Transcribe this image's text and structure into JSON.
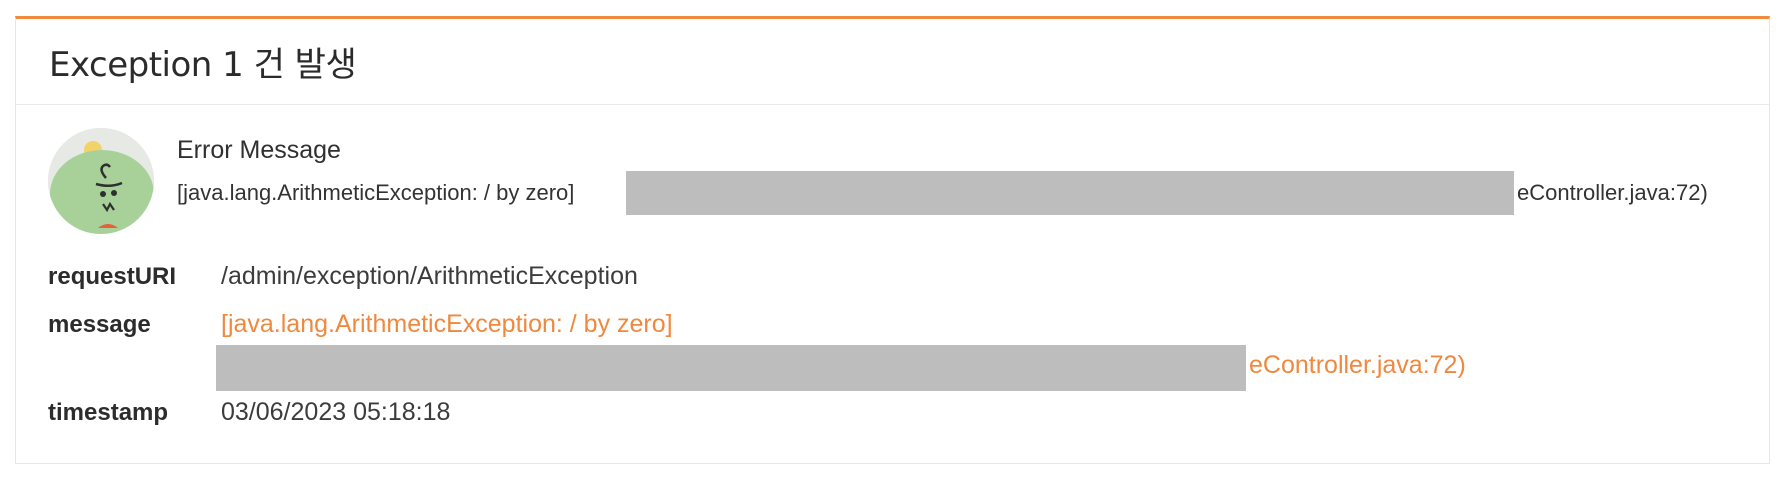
{
  "header": {
    "title": "Exception 1 건 발생"
  },
  "error": {
    "title": "Error Message",
    "line_start": "[java.lang.ArithmeticException: / by zero]",
    "line_end": "eController.java:72)"
  },
  "details": {
    "request_uri_label": "requestURI",
    "request_uri_value": "/admin/exception/ArithmeticException",
    "message_label": "message",
    "message_value": "[java.lang.ArithmeticException: / by zero]",
    "message_tail": "eController.java:72)",
    "timestamp_label": "timestamp",
    "timestamp_value": "03/06/2023 05:18:18"
  },
  "colors": {
    "accent": "#f0883e",
    "redaction": "#bdbdbd"
  }
}
